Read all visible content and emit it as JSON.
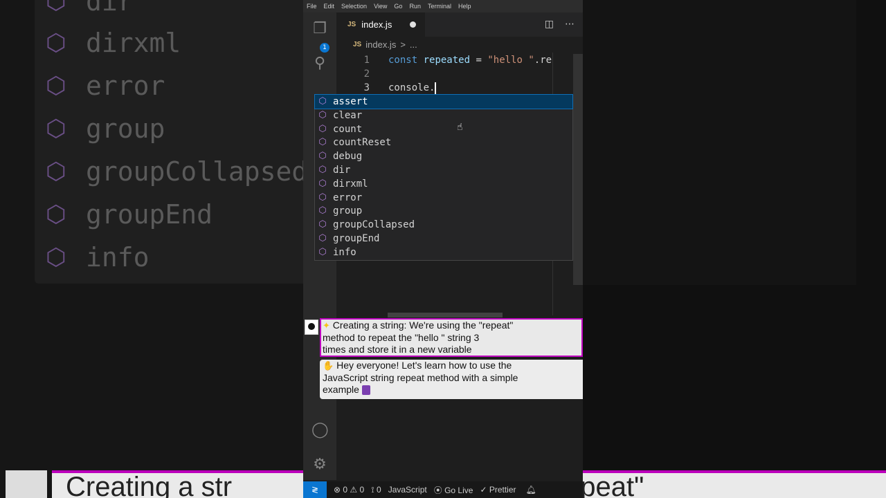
{
  "menu": [
    "File",
    "Edit",
    "Selection",
    "View",
    "Go",
    "Run",
    "Terminal",
    "Help"
  ],
  "activity": {
    "badge": "1"
  },
  "tab": {
    "icon": "JS",
    "label": "index.js"
  },
  "breadcrumb": {
    "icon": "JS",
    "file": "index.js",
    "sep": ">",
    "more": "..."
  },
  "editor": {
    "lines": [
      {
        "num": "1",
        "kw": "const",
        "var": "repeated",
        "op": "=",
        "str": "\"hello \"",
        "tail": ".re"
      },
      {
        "num": "2"
      },
      {
        "num": "3",
        "text": "console."
      }
    ]
  },
  "suggestions": [
    "assert",
    "clear",
    "count",
    "countReset",
    "debug",
    "dir",
    "dirxml",
    "error",
    "group",
    "groupCollapsed",
    "groupEnd",
    "info"
  ],
  "captions": {
    "c1_line1": "Creating a string: We're using the \"repeat\"",
    "c1_line2": "method to repeat the  \"hello \" string 3",
    "c1_line3": "times and store it in a new variable",
    "c2_line1": "Hey everyone! Let's learn how to use the",
    "c2_line2": "JavaScript string repeat method with a simple",
    "c2_line3": "example"
  },
  "background": {
    "items": [
      "dir",
      "dirxml",
      "error",
      "group",
      "groupCollapsed",
      "groupEnd",
      "info"
    ],
    "caption_text": "Creating a str",
    "caption_tail": "e \"repeat\""
  },
  "status": {
    "errors": "0",
    "warnings": "0",
    "ports": "0",
    "language": "JavaScript",
    "golive": "Go Live",
    "prettier": "Prettier"
  }
}
